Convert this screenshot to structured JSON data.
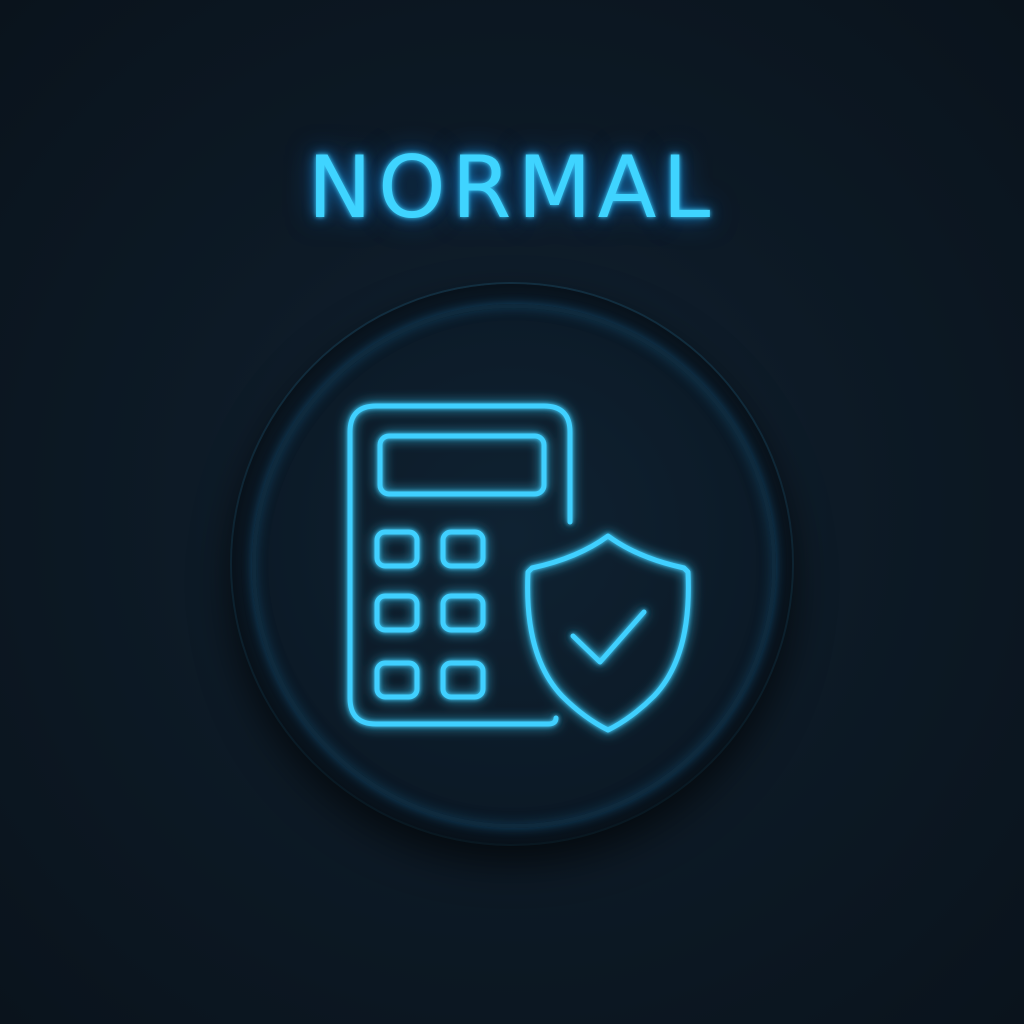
{
  "status": {
    "label": "NORMAL"
  },
  "icons": {
    "calculator": "calculator-icon",
    "shield": "shield-check-icon"
  },
  "colors": {
    "accent": "#3fd4ff",
    "background": "#0d1a26",
    "button": "#0c1a27"
  }
}
